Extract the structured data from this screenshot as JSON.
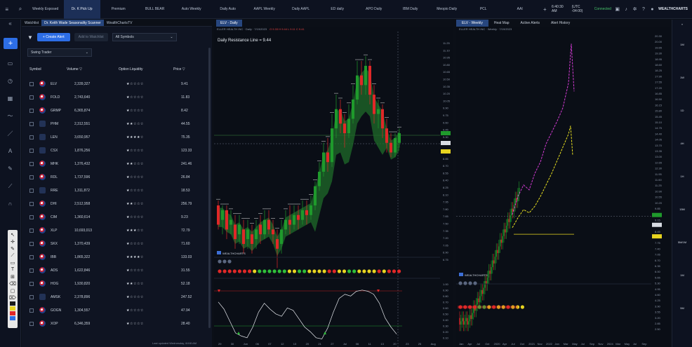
{
  "topbar": {
    "tabs": [
      {
        "label": "Weekly Exposed",
        "active": false
      },
      {
        "label": "Dr. K Pick Up",
        "active": true
      },
      {
        "label": "Premium",
        "active": false
      },
      {
        "label": "BULL BEAR",
        "active": false
      },
      {
        "label": "Auto Weekly",
        "active": false
      },
      {
        "label": "Daily Auto",
        "active": false
      },
      {
        "label": "AAPL Weekly",
        "active": false
      },
      {
        "label": "Daily AAPL",
        "active": false
      },
      {
        "label": "ED daily",
        "active": false
      },
      {
        "label": "APO Daily",
        "active": false
      },
      {
        "label": "IBM Daily",
        "active": false
      },
      {
        "label": "Meopio Daily",
        "active": false
      },
      {
        "label": "PCL",
        "active": false
      },
      {
        "label": "AAI",
        "active": false
      }
    ],
    "time": "6:40:30 AM",
    "timezone": "(UTC -04:00)",
    "status": "Connected",
    "brand": "WEALTHCHARTS"
  },
  "watchlist": {
    "tabs": [
      "Watchlist",
      "Dr. Keith Wade Seasonality Scanner",
      "WealthChartsTV"
    ],
    "active_tab": 1,
    "create_alert": "Create Alert",
    "add_watchlist": "Add to Watchlist",
    "symbols_select": "All Symbols",
    "filter_select": "Swing Trader",
    "columns": {
      "symbol": "Symbol",
      "volume": "Volume",
      "liquidity": "Option Liquidity",
      "price": "Price"
    },
    "rows": [
      {
        "symbol": "ELV",
        "volume": "2,339,327",
        "stars": "★☆☆☆☆",
        "price": "9.41",
        "logo": false
      },
      {
        "symbol": "FOLD",
        "volume": "2,743,640",
        "stars": "★☆☆☆☆",
        "price": "11.83",
        "logo": false
      },
      {
        "symbol": "GRMP",
        "volume": "6,365,874",
        "stars": "★☆☆☆☆",
        "price": "8.42",
        "logo": false
      },
      {
        "symbol": "PHM",
        "volume": "2,312,551",
        "stars": "★★☆☆☆",
        "price": "44.55",
        "logo": true
      },
      {
        "symbol": "LEN",
        "volume": "3,650,957",
        "stars": "★★★★☆",
        "price": "75.35",
        "logo": true
      },
      {
        "symbol": "CSX",
        "volume": "1,876,256",
        "stars": "★☆☆☆☆",
        "price": "123.33",
        "logo": true
      },
      {
        "symbol": "MHK",
        "volume": "1,376,432",
        "stars": "★★☆☆☆",
        "price": "241.46",
        "logo": false
      },
      {
        "symbol": "RDL",
        "volume": "1,737,596",
        "stars": "★☆☆☆☆",
        "price": "26.84",
        "logo": false
      },
      {
        "symbol": "RRE",
        "volume": "1,311,872",
        "stars": "★☆☆☆☆",
        "price": "18.53",
        "logo": true
      },
      {
        "symbol": "DHI",
        "volume": "2,512,958",
        "stars": "★★☆☆☆",
        "price": "256.79",
        "logo": false
      },
      {
        "symbol": "CIM",
        "volume": "1,360,614",
        "stars": "★☆☆☆☆",
        "price": "9.23",
        "logo": false
      },
      {
        "symbol": "XLP",
        "volume": "10,693,013",
        "stars": "★★★☆☆",
        "price": "72.79",
        "logo": false
      },
      {
        "symbol": "SKX",
        "volume": "1,370,439",
        "stars": "★☆☆☆☆",
        "price": "71.60",
        "logo": false
      },
      {
        "symbol": "IBB",
        "volume": "1,865,322",
        "stars": "★★★★☆",
        "price": "133.03",
        "logo": false
      },
      {
        "symbol": "ADS",
        "volume": "1,622,846",
        "stars": "★☆☆☆☆",
        "price": "31.55",
        "logo": false
      },
      {
        "symbol": "HOG",
        "volume": "1,930,820",
        "stars": "★★☆☆☆",
        "price": "52.18",
        "logo": false
      },
      {
        "symbol": "AMSK",
        "volume": "2,378,896",
        "stars": "★☆☆☆☆",
        "price": "247.52",
        "logo": true
      },
      {
        "symbol": "GOGN",
        "volume": "1,304,557",
        "stars": "★☆☆☆☆",
        "price": "47.94",
        "logo": false
      },
      {
        "symbol": "XOP",
        "volume": "6,346,359",
        "stars": "★☆☆☆☆",
        "price": "28.40",
        "logo": false
      }
    ],
    "footer": "Last updated Wednesday, 8/4/8 AM"
  },
  "chart1": {
    "tab": "ELV - Daily",
    "subtitle": "ELLER HEALTH INC · Daily · 7/19/2023",
    "ohlc": "O 9.33 H 9.44 L 9.11 C 9.41",
    "title": "Daily Resistance Line = 9.44",
    "logo": "WEALTHCHARTS",
    "price_labels": [
      "11.25",
      "11.10",
      "10.95",
      "10.80",
      "10.65",
      "10.50",
      "10.35",
      "10.20",
      "10.05",
      "9.90",
      "9.75",
      "9.60",
      "9.45",
      "9.30",
      "9.15",
      "9.00",
      "8.85",
      "8.70",
      "8.55",
      "8.40",
      "8.25",
      "8.10",
      "7.95",
      "7.80",
      "7.65",
      "7.50",
      "7.35",
      "7.20",
      "7.05",
      "6.90",
      "6.75"
    ],
    "osc_labels": [
      "1.00",
      "0.90",
      "0.80",
      "0.70",
      "0.60",
      "0.50",
      "0.40",
      "0.30",
      "0.20",
      "0.10"
    ],
    "time_labels": [
      "29",
      "30",
      "Jun",
      "06",
      "07",
      "12",
      "13",
      "20",
      "21",
      "27",
      "Jul",
      "06",
      "11",
      "13",
      "20",
      "23",
      "25",
      "Aug"
    ],
    "dot_colors": [
      "#e02828",
      "#e02828",
      "#e02828",
      "#e02828",
      "#e02828",
      "#e02828",
      "#e02828",
      "#e8d420",
      "#2fbf3a",
      "#2fbf3a",
      "#2fbf3a",
      "#2fbf3a",
      "#2fbf3a",
      "#2fbf3a",
      "#e8d420",
      "#e8d420",
      "#2fbf3a",
      "#2fbf3a",
      "#e8d420",
      "#e8d420",
      "#e8d420",
      "#e8d420",
      "#e02828",
      "#e02828",
      "#e8d420",
      "#e8d420",
      "#2fbf3a",
      "#2fbf3a",
      "#e8d420",
      "#e8d420",
      "#e8d420",
      "#e8d420",
      "#e02828",
      "#e8d420",
      "#e02828",
      "#e02828",
      "#e02828"
    ]
  },
  "chart2": {
    "tabs": [
      "ELV - Weekly",
      "Heat Map",
      "Active Alerts",
      "Alert History"
    ],
    "active_tab": 0,
    "subtitle": "ELLER HEALTH INC · Weekly · 7/19/2023",
    "price_labels": [
      "20.30",
      "20.00",
      "19.65",
      "19.30",
      "18.95",
      "18.60",
      "18.25",
      "17.90",
      "17.55",
      "17.20",
      "16.85",
      "16.50",
      "16.15",
      "15.80",
      "15.45",
      "15.10",
      "14.75",
      "14.40",
      "14.05",
      "13.70",
      "13.35",
      "13.00",
      "12.65",
      "12.30",
      "11.95",
      "11.60",
      "11.25",
      "10.90",
      "10.55",
      "10.20",
      "9.85",
      "9.50",
      "9.15",
      "8.80",
      "8.45",
      "8.10",
      "7.75",
      "7.40",
      "7.05",
      "6.70",
      "6.35",
      "6.00",
      "5.65",
      "5.30",
      "4.95",
      "4.60",
      "4.25",
      "3.90",
      "3.55",
      "3.20",
      "2.85",
      "2.50"
    ],
    "time_labels": [
      "Jan",
      "Apr",
      "Jul",
      "Oct",
      "2020",
      "Apr",
      "Jul",
      "Oct",
      "2021",
      "Nov",
      "2022",
      "Jan",
      "Mar",
      "May",
      "Jul",
      "Sep",
      "Nov",
      "2024",
      "Mar",
      "May",
      "Jul",
      "Sep"
    ],
    "dot_colors": [
      "#e02828",
      "#e02828",
      "#e02828",
      "#e02828",
      "#2fbf3a",
      "#2fbf3a",
      "#e8d420",
      "#e02828",
      "#e8d420",
      "#e8d420",
      "#e02828",
      "#e8d420",
      "#e8d420",
      "#e8d420"
    ],
    "logo": "WEALTHCHARTS"
  },
  "rightbar": {
    "items": [
      "1M",
      "1W",
      "1D",
      "4H",
      "1H",
      "15M",
      "5M/1M",
      "1M",
      "5M"
    ]
  }
}
